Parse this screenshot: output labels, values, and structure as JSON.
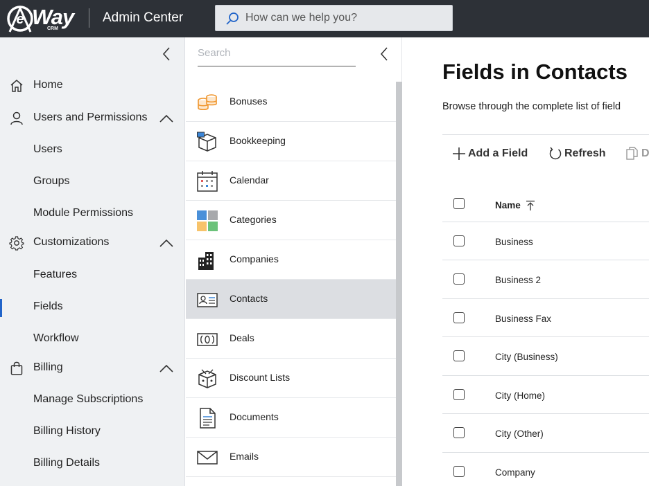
{
  "header": {
    "logo_text": "Way",
    "logo_sub": "CRM",
    "title": "Admin Center",
    "search_placeholder": "How can we help you?"
  },
  "nav": {
    "items": [
      {
        "label": "Home",
        "icon": "home-icon"
      },
      {
        "label": "Users and Permissions",
        "icon": "user-icon",
        "expanded": true
      },
      {
        "label": "Users"
      },
      {
        "label": "Groups"
      },
      {
        "label": "Module Permissions"
      },
      {
        "label": "Customizations",
        "icon": "gear-icon",
        "expanded": true
      },
      {
        "label": "Features"
      },
      {
        "label": "Fields",
        "active": true
      },
      {
        "label": "Workflow"
      },
      {
        "label": "Billing",
        "icon": "bag-icon",
        "expanded": true
      },
      {
        "label": "Manage Subscriptions"
      },
      {
        "label": "Billing History"
      },
      {
        "label": "Billing Details"
      }
    ]
  },
  "modules": {
    "search_placeholder": "Search",
    "items": [
      {
        "label": "Bonuses",
        "icon": "coins-icon"
      },
      {
        "label": "Bookkeeping",
        "icon": "box-icon"
      },
      {
        "label": "Calendar",
        "icon": "calendar-icon"
      },
      {
        "label": "Categories",
        "icon": "categories-icon"
      },
      {
        "label": "Companies",
        "icon": "building-icon"
      },
      {
        "label": "Contacts",
        "icon": "contact-card-icon",
        "active": true
      },
      {
        "label": "Deals",
        "icon": "deals-icon"
      },
      {
        "label": "Discount Lists",
        "icon": "discount-box-icon"
      },
      {
        "label": "Documents",
        "icon": "document-icon"
      },
      {
        "label": "Emails",
        "icon": "envelope-icon"
      }
    ]
  },
  "main": {
    "title": "Fields in Contacts",
    "description": "Browse through the complete list of field",
    "toolbar": {
      "add_label": "Add a Field",
      "refresh_label": "Refresh",
      "partial_label": "D"
    },
    "table": {
      "column_name": "Name",
      "rows": [
        "Business",
        "Business 2",
        "Business Fax",
        "City (Business)",
        "City (Home)",
        "City (Other)",
        "Company"
      ]
    }
  },
  "colors": {
    "topbar": "#2d3137",
    "accent": "#2164c9",
    "nav_bg": "#eff1f3"
  }
}
